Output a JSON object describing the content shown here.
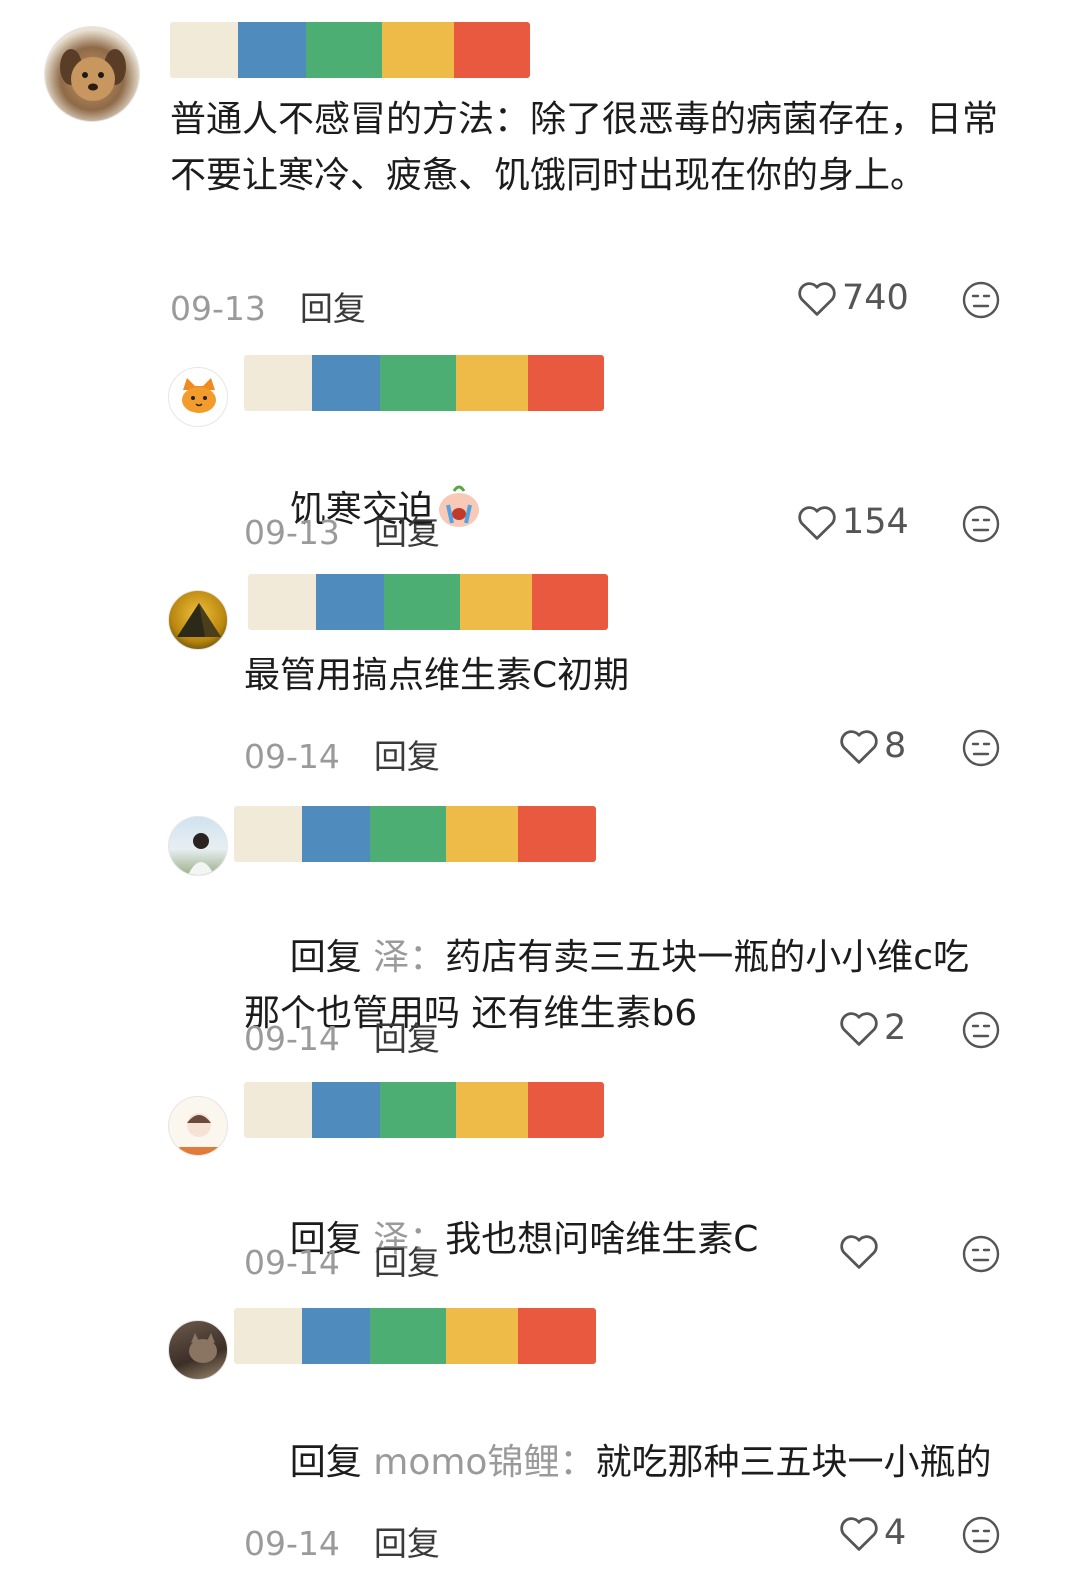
{
  "comments": [
    {
      "text": "普通人不感冒的方法：除了很恶毒的病菌存在，日常不要让寒冷、疲惫、饥饿同时出现在你的身上。",
      "date": "09-13",
      "reply_label": "回复",
      "likes": "740"
    },
    {
      "text": "饥寒交迫",
      "date": "09-13",
      "reply_label": "回复",
      "likes": "154"
    },
    {
      "text": "最管用搞点维生素C初期",
      "date": "09-14",
      "reply_label": "回复",
      "likes": "8"
    },
    {
      "reply_prefix": "回复",
      "reply_target": "泽：",
      "text": "药店有卖三五块一瓶的小小维c吃那个也管用吗 还有维生素b6",
      "date": "09-14",
      "reply_label": "回复",
      "likes": "2"
    },
    {
      "reply_prefix": "回复",
      "reply_target": "泽：",
      "text": "我也想问啥维生素C",
      "date": "09-14",
      "reply_label": "回复",
      "likes": ""
    },
    {
      "reply_prefix": "回复",
      "reply_target": "momo锦鲤：",
      "text": "就吃那种三五块一小瓶的",
      "date": "09-14",
      "reply_label": "回复",
      "likes": "4"
    }
  ],
  "icons": {
    "like": "heart-outline-icon",
    "dislike": "neutral-face-icon",
    "crying-emoji": "crying-face-emoji"
  },
  "colors": {
    "name_bar": [
      "#f1ead8",
      "#4f8bbd",
      "#4cae73",
      "#eebb48",
      "#e9593f"
    ],
    "meta_text": "#9a9a9a"
  }
}
